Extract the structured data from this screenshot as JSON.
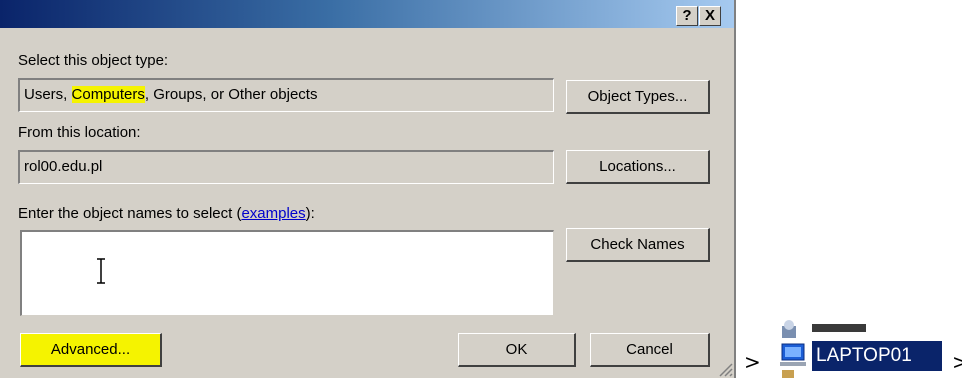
{
  "dialog": {
    "title_help": "?",
    "title_close": "X",
    "object_type_label": "Select this object type:",
    "object_type_value_pre": "Users, ",
    "object_type_value_hl": "Computers",
    "object_type_value_post": ", Groups, or Other objects",
    "object_types_button": "Object Types...",
    "location_label": "From this location:",
    "location_value": "rol00.edu.pl",
    "locations_button": "Locations...",
    "enter_label_pre": "Enter the object names to select (",
    "enter_label_link": "examples",
    "enter_label_post": "):",
    "names_value": "",
    "check_names_button": "Check Names",
    "advanced_button": "Advanced...",
    "ok_button": "OK",
    "cancel_button": "Cancel"
  },
  "background": {
    "arrow1": ">",
    "arrow2": ">",
    "selected_item": "LAPTOP01"
  },
  "colors": {
    "highlight": "#f5f300",
    "title_gradient_start": "#0a246a",
    "selection": "#0a246a"
  }
}
